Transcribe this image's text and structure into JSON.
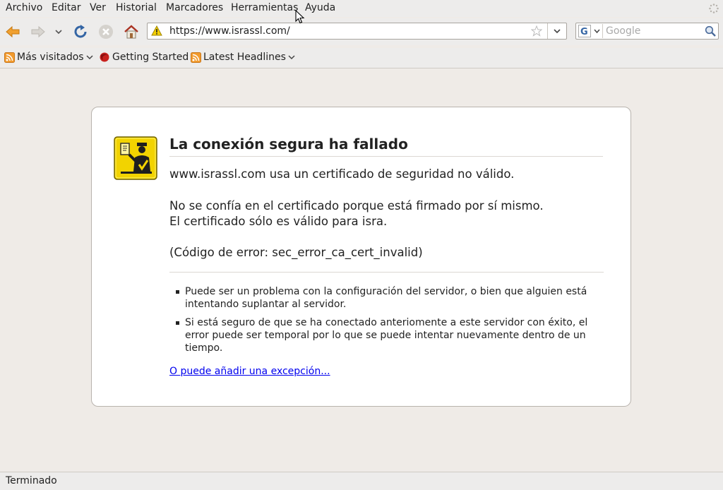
{
  "menu": [
    "Archivo",
    "Editar",
    "Ver",
    "Historial",
    "Marcadores",
    "Herramientas",
    "Ayuda"
  ],
  "url": "https://www.israssl.com/",
  "search": {
    "placeholder": "Google"
  },
  "bookmarks": [
    "Más visitados",
    "Getting Started",
    "Latest Headlines"
  ],
  "error": {
    "title": "La conexión segura ha fallado",
    "line1": "www.israssl.com usa un certificado de seguridad no válido.",
    "line2": "No se confía en el certificado porque está firmado por sí mismo.",
    "line3": "El certificado sólo es válido para isra.",
    "code": "(Código de error: sec_error_ca_cert_invalid)",
    "bullets": [
      "Puede ser un problema con la configuración del servidor, o bien que alguien está intentando suplantar al servidor.",
      "Si está seguro de que se ha conectado anteriomente a este servidor con éxito, el error puede ser temporal por lo que se puede intentar nuevamente dentro de un tiempo."
    ],
    "exception_link": "O puede añadir una excepción..."
  },
  "status": "Terminado",
  "colors": {
    "link": "#0000ee",
    "icon_yellow": "#e8c800",
    "accent_blue": "#3465a4"
  }
}
